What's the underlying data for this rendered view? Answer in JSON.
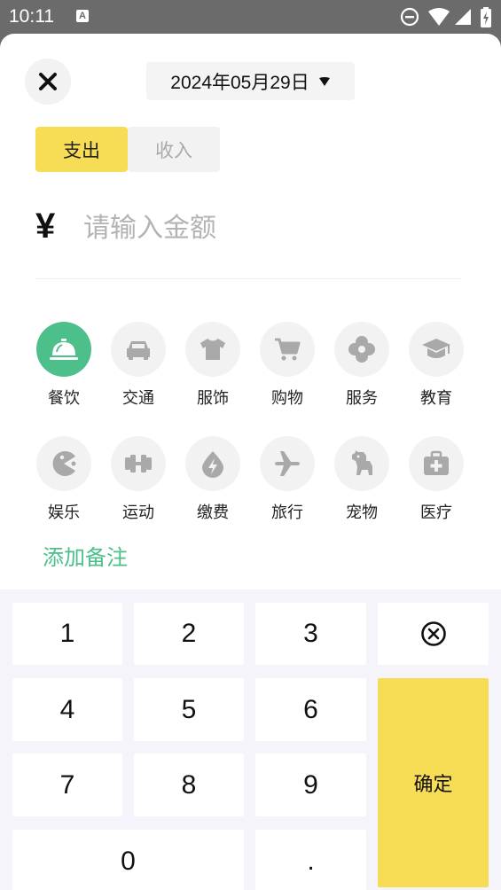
{
  "status_bar": {
    "time": "10:11",
    "notification_icon": "a-icon",
    "system_icons": [
      "do-not-disturb-icon",
      "wifi-icon",
      "signal-icon",
      "battery-icon"
    ]
  },
  "header": {
    "close_icon": "close-icon",
    "date": "2024年05月29日",
    "date_caret_icon": "caret-down-icon"
  },
  "type_toggle": {
    "expense_label": "支出",
    "income_label": "收入",
    "selected": "支出"
  },
  "amount": {
    "currency_symbol": "¥",
    "value": "",
    "placeholder": "请输入金额"
  },
  "categories": [
    {
      "label": "餐饮",
      "icon": "dining-cloche-icon",
      "selected": true
    },
    {
      "label": "交通",
      "icon": "car-icon",
      "selected": false
    },
    {
      "label": "服饰",
      "icon": "tshirt-icon",
      "selected": false
    },
    {
      "label": "购物",
      "icon": "shopping-cart-icon",
      "selected": false
    },
    {
      "label": "服务",
      "icon": "service-flower-icon",
      "selected": false
    },
    {
      "label": "教育",
      "icon": "graduation-cap-icon",
      "selected": false
    },
    {
      "label": "娱乐",
      "icon": "game-pacman-icon",
      "selected": false
    },
    {
      "label": "运动",
      "icon": "dumbbell-icon",
      "selected": false
    },
    {
      "label": "缴费",
      "icon": "water-drop-bolt-icon",
      "selected": false
    },
    {
      "label": "旅行",
      "icon": "airplane-icon",
      "selected": false
    },
    {
      "label": "宠物",
      "icon": "dog-icon",
      "selected": false
    },
    {
      "label": "医疗",
      "icon": "medical-kit-icon",
      "selected": false
    }
  ],
  "note": {
    "add_label": "添加备注"
  },
  "keypad": {
    "keys": [
      "1",
      "2",
      "3",
      "4",
      "5",
      "6",
      "7",
      "8",
      "9",
      "0",
      "."
    ],
    "backspace_icon": "backspace-circle-x-icon",
    "confirm_label": "确定"
  },
  "colors": {
    "accent_yellow": "#f7dc55",
    "accent_green": "#4cbf8a",
    "icon_gray": "#a9a9a9",
    "circle_bg": "#f2f2f2"
  }
}
